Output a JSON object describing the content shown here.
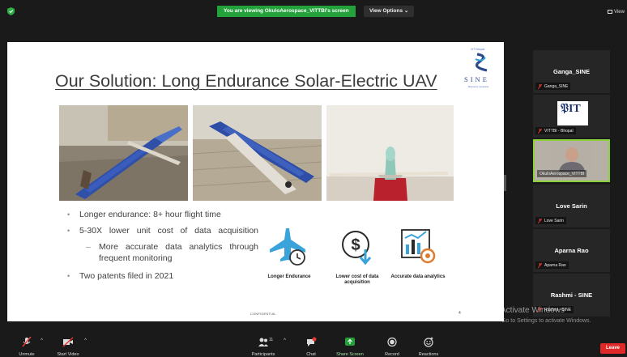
{
  "top_bar": {
    "banner": "You are viewing OkuloAerospace_VITTBI's screen",
    "view_options": "View Options",
    "view_link": "View"
  },
  "slide": {
    "title": "Our Solution: Long Endurance Solar-Electric UAV",
    "logo": {
      "top_text": "VIT Bhopal",
      "name": "SINE",
      "subtitle": "Business Incubator"
    },
    "bullets": [
      "Longer endurance: 8+ hour flight time",
      "5-30X lower unit cost of data acquisition",
      "More accurate data analytics through frequent monitoring",
      "Two patents filed in 2021"
    ],
    "features": [
      {
        "icon": "airplane-clock-icon",
        "label": "Longer Endurance"
      },
      {
        "icon": "dollar-down-icon",
        "label": "Lower cost of data acquisition"
      },
      {
        "icon": "analytics-chart-icon",
        "label": "Accurate data analytics"
      }
    ],
    "footer_confidential": "CONFIDENTIAL",
    "page_number": "4"
  },
  "participants": [
    {
      "name": "Ganga_SINE",
      "label": "Ganga_SINE",
      "muted": true
    },
    {
      "name": "VITTBI - Bhopal",
      "label": "VITTBI - Bhopal",
      "muted": true
    },
    {
      "name": "OkuloAerospace_VITTBI",
      "label": "OkuloAerospace_VITTBI",
      "muted": false
    },
    {
      "name": "Love Sarin",
      "label": "Love Sarin",
      "muted": true
    },
    {
      "name": "Aparna Rao",
      "label": "Aparna Rao",
      "muted": true
    },
    {
      "name": "Rashmi - SINE",
      "label": "Rashmi - SINE",
      "muted": true
    }
  ],
  "watermark": {
    "line1": "Activate Windows",
    "line2": "Go to Settings to activate Windows."
  },
  "toolbar": {
    "unmute": "Unmute",
    "start_video": "Start Video",
    "participants": "Participants",
    "participants_count": "11",
    "chat": "Chat",
    "share_screen": "Share Screen",
    "record": "Record",
    "reactions": "Reactions",
    "leave": "Leave"
  },
  "colors": {
    "banner_green": "#23a13b",
    "active_speaker_border": "#8bd33a",
    "leave_red": "#e02828",
    "muted_red": "#e53935"
  }
}
